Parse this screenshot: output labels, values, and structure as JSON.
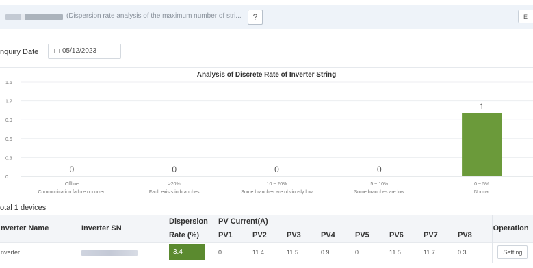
{
  "header": {
    "title": "(Dispersion rate analysis of the maximum number of stri...",
    "help_label": "?",
    "right_button_label": "E"
  },
  "filter": {
    "label": "nquiry Date",
    "date_value": "05/12/2023"
  },
  "chart_data": {
    "type": "bar",
    "title": "Analysis of Discrete Rate of Inverter String",
    "categories": [
      [
        "Offline",
        "Communication failure occurred"
      ],
      [
        "≥20%",
        "Fault exists in branches"
      ],
      [
        "10 ~ 20%",
        "Some branches are obviously low"
      ],
      [
        "5 ~ 10%",
        "Some branches are low"
      ],
      [
        "0 ~ 5%",
        "Normal"
      ]
    ],
    "values": [
      0,
      0,
      0,
      0,
      1
    ],
    "value_labels": [
      "0",
      "0",
      "0",
      "0",
      "1"
    ],
    "yticks": [
      "1.5",
      "1.2",
      "0.9",
      "0.6",
      "0.3",
      "0"
    ],
    "ylim": [
      0,
      1.5
    ],
    "bar_color": "#6b9a3a",
    "grid": true
  },
  "summary": {
    "total_text": "otal 1 devices"
  },
  "table": {
    "headers": {
      "inverter_name": "nverter Name",
      "inverter_sn": "Inverter SN",
      "dispersion_line1": "Dispersion",
      "dispersion_line2": "Rate (%)",
      "pv_current": "PV Current(A)",
      "operation": "Operation",
      "pv": [
        "PV1",
        "PV2",
        "PV3",
        "PV4",
        "PV5",
        "PV6",
        "PV7",
        "PV8"
      ]
    },
    "rows": [
      {
        "name": "nverter",
        "rate": "3.4",
        "pv": [
          "0",
          "11.4",
          "11.5",
          "0.9",
          "0",
          "11.5",
          "11.7",
          "0.3"
        ],
        "pv_highlight": [
          true,
          false,
          false,
          false,
          true,
          false,
          false,
          false
        ],
        "operation_label": "Setting"
      }
    ]
  },
  "colors": {
    "accent_green": "#5b8a2f",
    "warning_orange": "#e8922a"
  }
}
